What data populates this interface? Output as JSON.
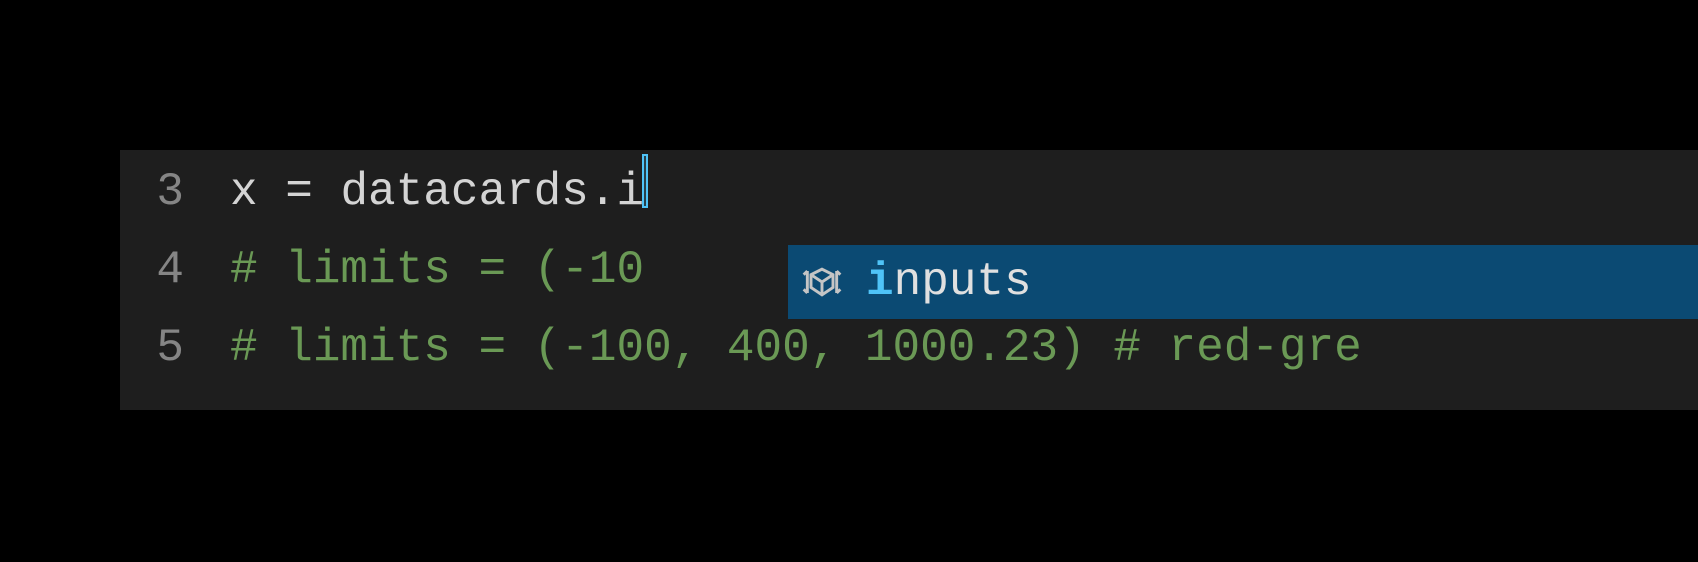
{
  "lines": [
    {
      "number": "3",
      "segments": [
        {
          "cls": "c-var",
          "text": "x "
        },
        {
          "cls": "c-op",
          "text": "= "
        },
        {
          "cls": "c-var",
          "text": "datacards"
        },
        {
          "cls": "c-op",
          "text": "."
        },
        {
          "cls": "c-var",
          "text": "i"
        }
      ],
      "has_cursor": true
    },
    {
      "number": "4",
      "segments": [
        {
          "cls": "c-comment",
          "text": "# limits = (-10"
        }
      ],
      "has_cursor": false
    },
    {
      "number": "5",
      "segments": [
        {
          "cls": "c-comment",
          "text": "# limits = (-100, 400, 1000.23) # red-gre"
        }
      ],
      "has_cursor": false
    }
  ],
  "autocomplete": {
    "match_prefix": "i",
    "match_rest": "nputs",
    "icon": "variable-icon"
  },
  "colors": {
    "background": "#1e1e1e",
    "gutter": "#858585",
    "text": "#d4d4d4",
    "comment": "#6a9955",
    "accent": "#4fc3f7",
    "popup": "#0b4a73"
  }
}
